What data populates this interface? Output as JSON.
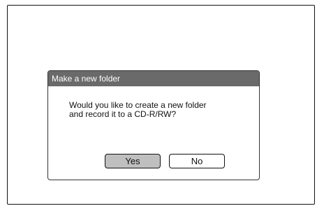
{
  "dialog": {
    "title": "Make a new folder",
    "message_lines": [
      "Would you like to create a new folder",
      "and record it to a CD-R/RW?"
    ],
    "buttons": {
      "yes_label": "Yes",
      "no_label": "No",
      "selected": "yes"
    }
  },
  "colors": {
    "titlebar": "#6a6a6a",
    "selected_button": "#bfbfbf",
    "border": "#111111"
  }
}
